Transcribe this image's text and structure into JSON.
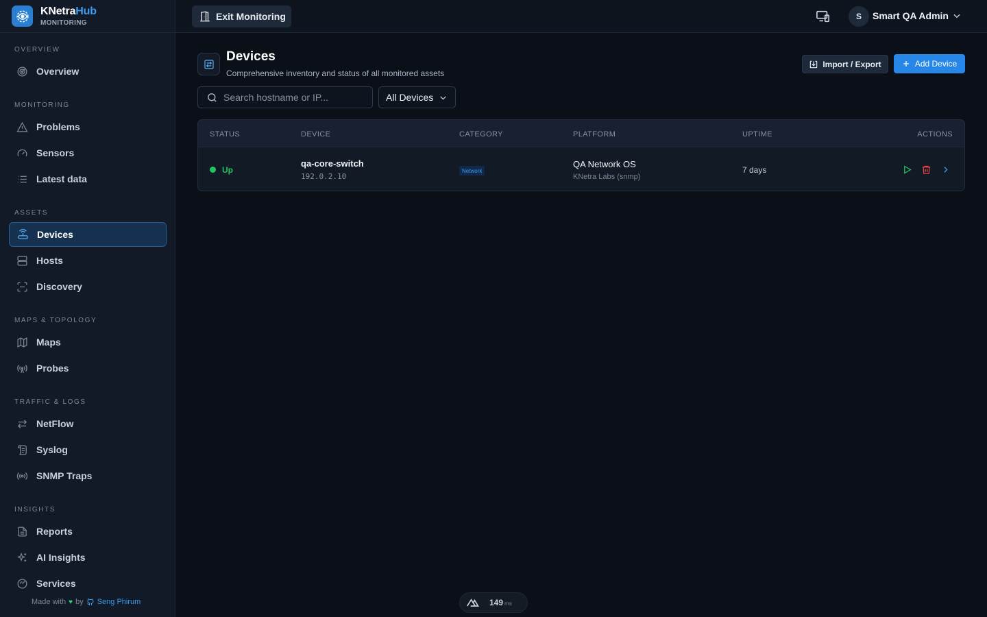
{
  "brand": {
    "name_main": "KNetra",
    "name_accent": "Hub",
    "subtitle": "MONITORING"
  },
  "sidebar": {
    "sections": [
      {
        "title": "OVERVIEW",
        "items": [
          {
            "label": "Overview",
            "icon": "target-icon"
          }
        ]
      },
      {
        "title": "MONITORING",
        "items": [
          {
            "label": "Problems",
            "icon": "warning-icon"
          },
          {
            "label": "Sensors",
            "icon": "gauge-icon"
          },
          {
            "label": "Latest data",
            "icon": "list-icon"
          }
        ]
      },
      {
        "title": "ASSETS",
        "items": [
          {
            "label": "Devices",
            "icon": "router-icon",
            "active": true
          },
          {
            "label": "Hosts",
            "icon": "server-icon"
          },
          {
            "label": "Discovery",
            "icon": "scan-icon"
          }
        ]
      },
      {
        "title": "MAPS & TOPOLOGY",
        "items": [
          {
            "label": "Maps",
            "icon": "map-icon"
          },
          {
            "label": "Probes",
            "icon": "radio-tower-icon"
          }
        ]
      },
      {
        "title": "TRAFFIC & LOGS",
        "items": [
          {
            "label": "NetFlow",
            "icon": "arrows-icon"
          },
          {
            "label": "Syslog",
            "icon": "scroll-icon"
          },
          {
            "label": "SNMP Traps",
            "icon": "broadcast-icon"
          }
        ]
      },
      {
        "title": "INSIGHTS",
        "items": [
          {
            "label": "Reports",
            "icon": "document-icon"
          },
          {
            "label": "AI Insights",
            "icon": "sparkles-icon"
          },
          {
            "label": "Services",
            "icon": "check-gauge-icon"
          }
        ]
      }
    ],
    "footer": {
      "made_with": "Made with",
      "by": "by",
      "author": "Seng Phirum"
    }
  },
  "topbar": {
    "exit_label": "Exit Monitoring",
    "user_initial": "S",
    "user_name": "Smart QA Admin"
  },
  "header": {
    "title": "Devices",
    "subtitle": "Comprehensive inventory and status of all monitored assets",
    "import_label": "Import / Export",
    "add_label": "Add Device"
  },
  "filters": {
    "search_placeholder": "Search hostname or IP...",
    "category_selected": "All Devices"
  },
  "table": {
    "columns": [
      "STATUS",
      "DEVICE",
      "CATEGORY",
      "PLATFORM",
      "UPTIME",
      "ACTIONS"
    ],
    "rows": [
      {
        "status": "Up",
        "name": "qa-core-switch",
        "ip": "192.0.2.10",
        "category": "Network",
        "platform": "QA Network OS",
        "vendor": "KNetra Labs (snmp)",
        "uptime": "7 days"
      }
    ]
  },
  "dev_indicator": {
    "ms_value": "149",
    "ms_unit": "ms"
  },
  "colors": {
    "accent": "#2787e8",
    "status_up": "#22c55e",
    "delete": "#ef4444"
  }
}
